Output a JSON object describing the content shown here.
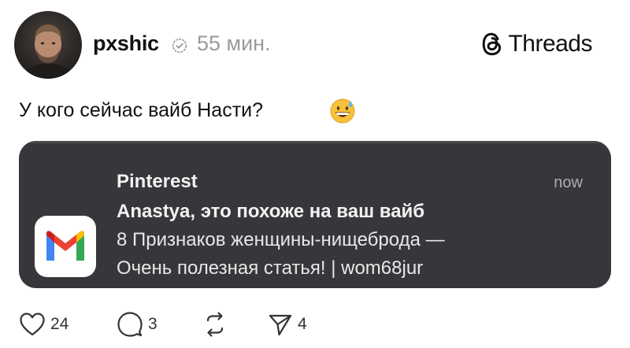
{
  "post": {
    "username": "pxshic",
    "time": "55 мин.",
    "brand": "Threads",
    "text": "У кого сейчас вайб Насти?",
    "emoji": "grinning-sweat-emoji"
  },
  "notification": {
    "app": "Pinterest",
    "time": "now",
    "title": "Anastya, это похоже на ваш вайб",
    "body_line1": "8 Признаков женщины-нищеброда —",
    "body_line2": "Очень полезная статья! | wom68jur",
    "app_icon": "gmail-icon"
  },
  "actions": {
    "likes": "24",
    "comments": "3",
    "shares": "4"
  },
  "colors": {
    "notification_bg": "#38363a",
    "muted": "#9a9a9a"
  }
}
